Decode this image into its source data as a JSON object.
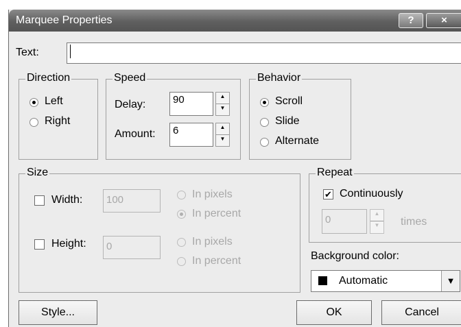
{
  "window": {
    "title": "Marquee Properties",
    "help_label": "?",
    "close_label": "×"
  },
  "text_field": {
    "label": "Text:",
    "value": ""
  },
  "direction": {
    "legend": "Direction",
    "options": [
      "Left",
      "Right"
    ],
    "selected": "Left"
  },
  "speed": {
    "legend": "Speed",
    "delay_label": "Delay:",
    "delay_value": "90",
    "amount_label": "Amount:",
    "amount_value": "6"
  },
  "behavior": {
    "legend": "Behavior",
    "options": [
      "Scroll",
      "Slide",
      "Alternate"
    ],
    "selected": "Scroll"
  },
  "size": {
    "legend": "Size",
    "width_label": "Width:",
    "width_value": "100",
    "width_checked": false,
    "height_label": "Height:",
    "height_value": "0",
    "height_checked": false,
    "unit_pixels": "In pixels",
    "unit_percent": "In percent",
    "width_unit_selected": "In percent"
  },
  "repeat": {
    "legend": "Repeat",
    "continuously_label": "Continuously",
    "continuously_checked": true,
    "count_value": "0",
    "times_label": "times"
  },
  "background_color": {
    "label": "Background color:",
    "value": "Automatic",
    "swatch": "#000000"
  },
  "buttons": {
    "style": "Style...",
    "ok": "OK",
    "cancel": "Cancel"
  },
  "colors": {
    "titlebar": "#5f5f5f",
    "dialog_bg": "#ececec",
    "disabled_text": "#a8a8a8"
  }
}
